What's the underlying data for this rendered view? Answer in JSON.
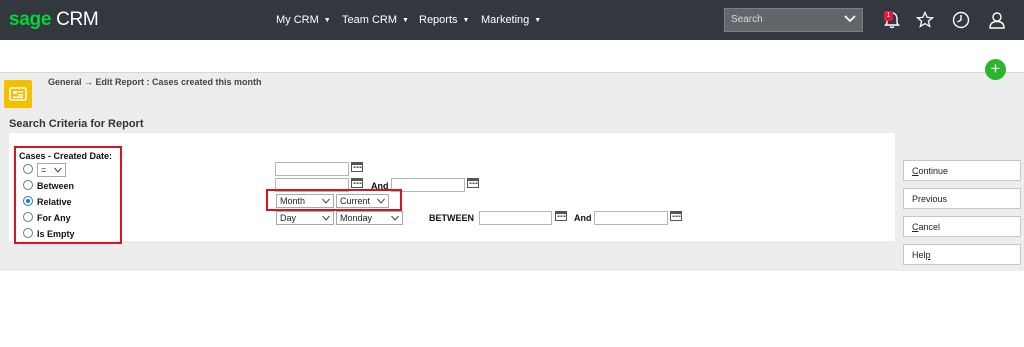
{
  "header": {
    "logo_brand": "sage",
    "logo_product": "CRM",
    "nav": [
      "My CRM",
      "Team CRM",
      "Reports",
      "Marketing"
    ],
    "search_placeholder": "Search",
    "notification_count": "1"
  },
  "breadcrumb": "General → Edit Report : Cases created this month",
  "section_title": "Search Criteria for Report",
  "criteria": {
    "field_label": "Cases - Created Date:",
    "operator_value": "=",
    "options": [
      "Between",
      "Relative",
      "For Any",
      "Is Empty"
    ],
    "relative_unit": "Month",
    "relative_period": "Current",
    "forany_unit": "Day",
    "forany_day": "Monday",
    "and_label": "And",
    "between_label": "BETWEEN"
  },
  "buttons": {
    "continue_rest": "ontinue",
    "continue_key": "C",
    "previous": "Previous",
    "cancel_key": "C",
    "cancel_rest": "ancel",
    "help_pre": "Hel",
    "help_key": "p"
  },
  "colors": {
    "brand_green": "#00d639",
    "header_bg": "#33383e",
    "highlight_red": "#d9141e",
    "add_green": "#2ab52a",
    "report_icon": "#f3c000"
  }
}
